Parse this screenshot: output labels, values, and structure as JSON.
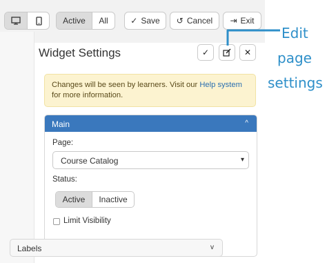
{
  "toolbar": {
    "device_desktop_icon": "desktop-monitor-icon",
    "device_mobile_icon": "mobile-phone-icon",
    "filter": {
      "options": [
        "Active",
        "All"
      ],
      "selected": "Active"
    },
    "save_label": "Save",
    "cancel_label": "Cancel",
    "exit_label": "Exit"
  },
  "panel": {
    "title": "Widget Settings",
    "actions": [
      "check-icon",
      "edit-icon",
      "close-icon"
    ]
  },
  "notice": {
    "text_before": "Changes will be seen by learners. Visit our ",
    "link_text": "Help system",
    "text_after": " for more information."
  },
  "main_section": {
    "header": "Main",
    "page_label": "Page:",
    "page_value": "Course Catalog",
    "status_label": "Status:",
    "status_options": [
      "Active",
      "Inactive"
    ],
    "status_selected": "Active",
    "limit_visibility_label": "Limit Visibility"
  },
  "labels_section": {
    "header": "Labels"
  },
  "callout": {
    "line1": "Edit",
    "line2": "page",
    "line3": "settings"
  },
  "colors": {
    "accent": "#3a78bd",
    "callout": "#2e8fc9",
    "notice_bg": "#fcf3d0"
  }
}
